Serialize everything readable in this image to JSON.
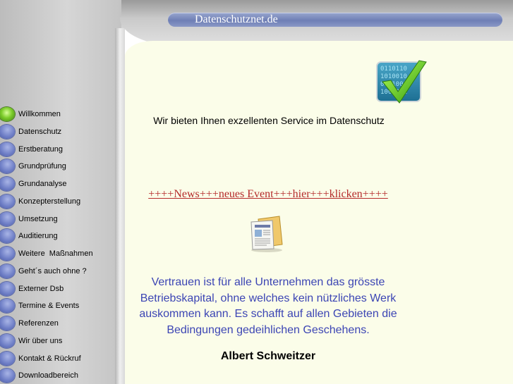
{
  "header": {
    "site_title": "Datenschutznet.de"
  },
  "nav": {
    "items": [
      {
        "label": "Willkommen",
        "active": true
      },
      {
        "label": "Datenschutz"
      },
      {
        "label": "Erstberatung"
      },
      {
        "label": "Grundprüfung"
      },
      {
        "label": "Grundanalyse"
      },
      {
        "label": "Konzepterstellung"
      },
      {
        "label": "Umsetzung"
      },
      {
        "label": "Auditierung"
      },
      {
        "label": "Weitere  Maßnahmen"
      },
      {
        "label": "Geht´s auch ohne ?"
      },
      {
        "label": "Externer Dsb"
      },
      {
        "label": "Termine & Events"
      },
      {
        "label": "Referenzen"
      },
      {
        "label": "Wir über uns"
      },
      {
        "label": "Kontakt & Rückruf"
      },
      {
        "label": "Downloadbereich"
      }
    ]
  },
  "main": {
    "tagline": "Wir bieten Ihnen exzellenten Service im Datenschutz",
    "news_link": "++++News+++neues Event+++hier+++klicken++++",
    "quote_lines": [
      "Vertrauen ist für alle Unternehmen das grösste",
      "Betriebskapital, ohne welches kein nützliches Werk",
      "auskommen kann. Es schafft auf allen Gebieten die",
      "Bedingungen gedeihlichen Geschehens."
    ],
    "author": "Albert Schweitzer"
  },
  "icons": {
    "logo": "binary-checkmark-icon",
    "news": "newspaper-icon",
    "active_bullet": "green-sphere-icon",
    "bullet": "blue-tab-icon"
  },
  "colors": {
    "content_bg": "#fbfde9",
    "news_link": "#b52a2a",
    "quote": "#3c45b4",
    "header_pill": "#6f7fb5"
  }
}
